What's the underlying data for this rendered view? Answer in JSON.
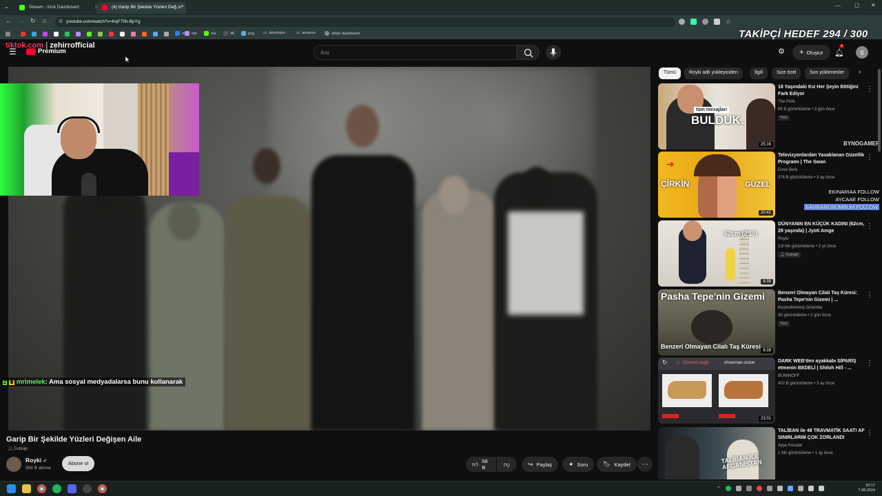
{
  "browser": {
    "tabs": [
      {
        "label": "Stream - Kick Dashboard",
        "active": false
      },
      {
        "label": "(4) Garip Bir Şekilde Yüzleri Değ...",
        "active": true
      }
    ],
    "url": "youtube.com/watch?v=KqF75h-BpYg",
    "bookmarks": [
      "me",
      "me",
      "4K",
      "png",
      "developer",
      "amazon",
      "stripe dashboard"
    ]
  },
  "overlay": {
    "follower_goal": "TAKİPÇİ HEDEF 294 / 300",
    "tiktok_prefix": "tiktok.com",
    "tiktok_handle": "zehirrofficial",
    "chat_user": "mrlmelek",
    "chat_text": ": Ama sosyal medyadalarsa bunu kullanarak",
    "follows": [
      "BYNOGAMEF",
      "EKINARIAA FOLLOW",
      "AYCAAE FOLLOW",
      "BAMBAMUBUMBUM FOLLOW"
    ]
  },
  "youtube": {
    "logo_text": "Premium",
    "search_placeholder": "Ara",
    "create_label": "Oluştur",
    "notif_count": "4",
    "avatar_letter": "g"
  },
  "video": {
    "title": "Garip Bir Şekilde Yüzleri Değişen Aile",
    "dubbed": "Dublajlı",
    "channel": "Royki",
    "subscribers": "958 B abone",
    "subscribe_label": "Abone ol",
    "likes": "58 B",
    "share_label": "Paylaş",
    "ask_label": "Soru",
    "save_label": "Kaydet"
  },
  "chips": [
    "Tümü",
    "Royki adlı yükleyiciden",
    "İlgili",
    "Size özel",
    "Son yüklenenler"
  ],
  "recommendations": [
    {
      "title": "18 Yaşındaki Kız Her Şeyin Bittiğini Fark Ediyor",
      "channel": "The Polis",
      "meta": "65 B görüntüleme • 3 gün önce",
      "badge": "Yeni",
      "duration": "25:16",
      "thumb_text": "tüm mesajları BULDUK."
    },
    {
      "title": "Televizyonlardan Yasaklanan Güzellik Programı | The Swan",
      "channel": "Emre Berk",
      "meta": "376 B görüntüleme • 3 ay önce",
      "badge": "",
      "duration": "20:42",
      "thumb_text_left": "ÇİRKİN",
      "thumb_text_right": "GÜZEL"
    },
    {
      "title": "DÜNYANIN EN KÜÇÜK KADINI (62cm, 29 yaşında) | Jyoti Amge",
      "channel": "Royki",
      "meta": "3,8 Mn görüntüleme • 2 yıl önce",
      "badge": "Dublajlı",
      "duration": "8:35",
      "thumb_text": "62cm (2'1\")"
    },
    {
      "title": "Benzeri Olmayan Cilalı Taş Küresi: Pasha Tepe'nin Gizemi | ...",
      "channel": "Keşfedilmemiş Gizemler",
      "meta": "30 görüntüleme • 1 gün önce",
      "badge": "Yeni",
      "duration": "6:28",
      "thumb_text": "Pasha Tepe'nin Gizemi",
      "thumb_text_bottom": "Benzeri Olmayan Cilalı Taş Küresi"
    },
    {
      "title": "DARK WEB'den ayakkabı SİPARİŞ etmenin BEDELİ | Shiloh Hill - ...",
      "channel": "BUMINOFF",
      "meta": "402 B görüntüleme • 3 ay önce",
      "badge": "",
      "duration": "23:01",
      "thumb_text": "Güvenli değil",
      "thumb_url": "shoeman.onion"
    },
    {
      "title": "TALİBAN ile 48 TRAVMATİK SAAT! AF SINIRLARIM ÇOK ZORLANDI",
      "channel": "Ayşe Kocalar",
      "meta": "1 Mn görüntüleme • 1 ay önce",
      "badge": "",
      "duration": "",
      "thumb_text": "TALİBAN İLE AFGANİSTAN"
    }
  ],
  "clock": {
    "time": "20:17",
    "date": "7.08.2024"
  }
}
